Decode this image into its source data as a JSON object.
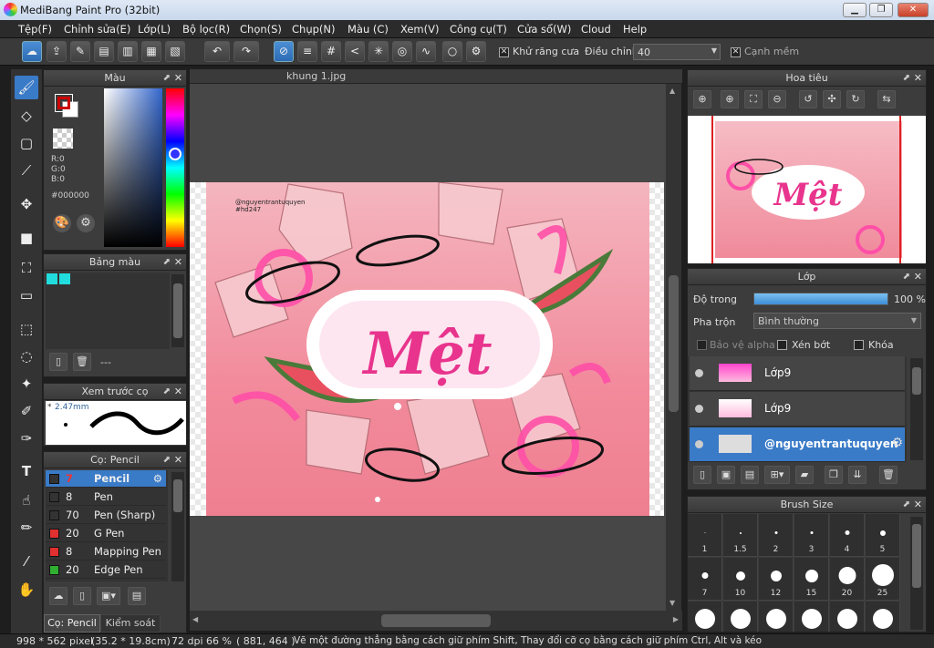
{
  "window": {
    "title": "MediBang Paint Pro (32bit)",
    "minimize": "▁",
    "restore": "❐",
    "close": "✕"
  },
  "menu": [
    "Tệp(F)",
    "Chỉnh sửa(E)",
    "Lớp(L)",
    "Bộ lọc(R)",
    "Chọn(S)",
    "Chụp(N)",
    "Màu (C)",
    "Xem(V)",
    "Công cụ(T)",
    "Cửa sổ(W)",
    "Cloud",
    "Help"
  ],
  "toolbar": {
    "antialias_label": "Khử răng cưa",
    "adjust_label": "Điều chỉnh",
    "adjust_value": "40",
    "soft_edge_label": "Cạnh mềm",
    "antialias_checked": "✕",
    "soft_edge_checked": "✕"
  },
  "color_panel": {
    "title": "Màu",
    "r": "R:0",
    "g": "G:0",
    "b": "B:0",
    "hex": "#000000",
    "fg": "#000000",
    "bg": "#ffffff"
  },
  "palette_panel": {
    "title": "Bảng màu",
    "swatches": [
      "#22dddd",
      "#22dddd"
    ],
    "footer": "---"
  },
  "brush_preview": {
    "title": "Xem trước cọ",
    "size": "2.47mm",
    "marker": "*"
  },
  "brush_panel": {
    "title": "Cọ: Pencil",
    "items": [
      {
        "size": "7",
        "name": "Pencil",
        "color": "#333333"
      },
      {
        "size": "8",
        "name": "Pen",
        "color": "#333333"
      },
      {
        "size": "70",
        "name": "Pen (Sharp)",
        "color": "#333333"
      },
      {
        "size": "20",
        "name": "G Pen",
        "color": "#e03030"
      },
      {
        "size": "8",
        "name": "Mapping Pen",
        "color": "#e03030"
      },
      {
        "size": "20",
        "name": "Edge Pen",
        "color": "#30b030"
      }
    ],
    "tabs": [
      "Cọ: Pencil",
      "Kiểm soát cọ"
    ]
  },
  "canvas": {
    "tab": "khung 1.jpg",
    "watermark": "@nguyentrantuquyen\n#hd247",
    "text": "Mệt"
  },
  "navigator": {
    "title": "Hoa tiêu"
  },
  "layers": {
    "title": "Lớp",
    "opacity_label": "Độ trong",
    "opacity_value": "100 %",
    "opacity_fraction": 1.0,
    "blend_label": "Pha trộn",
    "blend_value": "Bình thường",
    "protect_alpha": "Bảo vệ alpha",
    "clip": "Xén bớt",
    "lock": "Khóa",
    "items": [
      {
        "name": "Lớp9",
        "selected": false
      },
      {
        "name": "Lớp9",
        "selected": false
      },
      {
        "name": "@nguyentrantuquyen",
        "selected": true
      }
    ]
  },
  "brush_size": {
    "title": "Brush Size",
    "sizes": [
      "1",
      "1.5",
      "2",
      "3",
      "4",
      "5",
      "7",
      "10",
      "12",
      "15",
      "20",
      "25"
    ]
  },
  "status": {
    "dimensions": "998 * 562 pixel",
    "physical": "(35.2 * 19.8cm)",
    "dpi": "72 dpi",
    "zoom": "66 %",
    "coords": "( 881, 464 )",
    "hint": "Vẽ một đường thẳng bằng cách giữ phím Shift, Thay đổi cỡ cọ bằng cách giữ phím Ctrl, Alt và kéo"
  }
}
